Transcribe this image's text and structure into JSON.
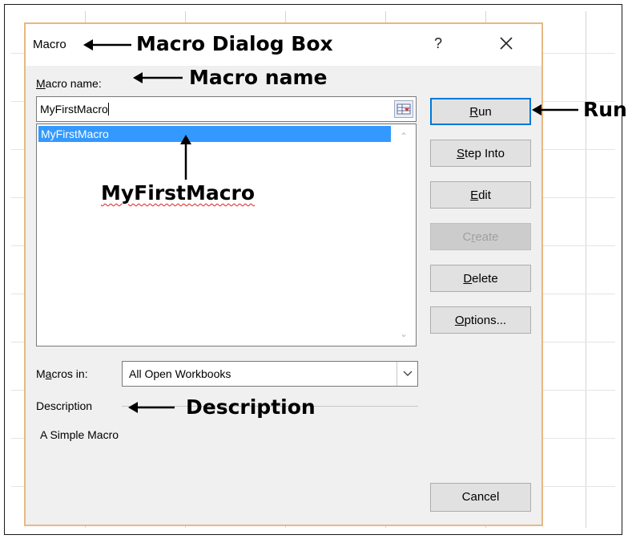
{
  "dialog": {
    "title": "Macro",
    "help_label": "?",
    "macro_name_label_prefix": "",
    "macro_name_label_mnemonic": "M",
    "macro_name_label_rest": "acro name:",
    "macro_name_value": "MyFirstMacro",
    "macro_list": [
      "MyFirstMacro"
    ],
    "macros_in_label_pre": "M",
    "macros_in_label_mnemonic": "a",
    "macros_in_label_rest": "cros in:",
    "macros_in_value": "All Open Workbooks",
    "description_label": "Description",
    "description_text": "A Simple Macro",
    "buttons": {
      "run": {
        "pre": "",
        "mn": "R",
        "post": "un"
      },
      "step_into": {
        "pre": "",
        "mn": "S",
        "post": "tep Into"
      },
      "edit": {
        "pre": "",
        "mn": "E",
        "post": "dit"
      },
      "create": {
        "pre": "C",
        "mn": "r",
        "post": "eate"
      },
      "delete": {
        "pre": "",
        "mn": "D",
        "post": "elete"
      },
      "options": {
        "pre": "",
        "mn": "O",
        "post": "ptions..."
      },
      "cancel": "Cancel"
    }
  },
  "annotations": {
    "dialog_box": "Macro Dialog Box",
    "macro_name": "Macro name",
    "my_first_macro": "MyFirstMacro",
    "run": "Run",
    "description": "Description"
  },
  "colors": {
    "selection": "#3399ff",
    "dialog_border": "#e8b883",
    "primary_border": "#0078d7"
  }
}
